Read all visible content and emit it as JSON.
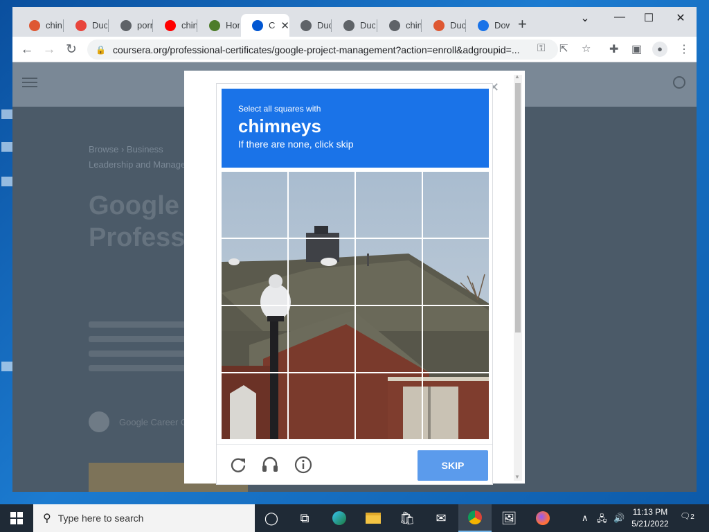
{
  "browser": {
    "tabs": [
      {
        "label": "chin",
        "icon": "duckduckgo-icon",
        "color": "#de5833"
      },
      {
        "label": "Duck",
        "icon": "images-icon",
        "color": "#e8453c"
      },
      {
        "label": "porn",
        "icon": "globe-icon",
        "color": "#5f6368"
      },
      {
        "label": "chin",
        "icon": "youtube-icon",
        "color": "#ff0000"
      },
      {
        "label": "Hom",
        "icon": "site-icon",
        "color": "#4d7c2a"
      },
      {
        "label": "C",
        "icon": "coursera-icon",
        "color": "#0056d2"
      },
      {
        "label": "Duck",
        "icon": "globe-icon",
        "color": "#5f6368"
      },
      {
        "label": "Duck",
        "icon": "globe-icon",
        "color": "#5f6368"
      },
      {
        "label": "chin",
        "icon": "globe-icon",
        "color": "#5f6368"
      },
      {
        "label": "Duck",
        "icon": "duckduckgo-icon",
        "color": "#de5833"
      },
      {
        "label": "Dow",
        "icon": "download-icon",
        "color": "#1a73e8"
      }
    ],
    "active_tab_index": 5,
    "url": "coursera.org/professional-certificates/google-project-management?action=enroll&adgroupid=..."
  },
  "page": {
    "breadcrumb_1": "Browse  ›  Business",
    "breadcrumb_2": "Leadership and Management",
    "hero_title": "Google Project Management: Professional Certificate",
    "provider": "Google Career Certificates"
  },
  "captcha": {
    "instruction_small": "Select all squares with",
    "target": "chimneys",
    "instruction_sub": "If there are none, click skip",
    "skip_label": "SKIP"
  },
  "taskbar": {
    "search_placeholder": "Type here to search",
    "time": "11:13 PM",
    "date": "5/21/2022",
    "notification_count": "2"
  },
  "colors": {
    "captcha_blue": "#1a73e8",
    "skip_button": "#5b9bec"
  }
}
